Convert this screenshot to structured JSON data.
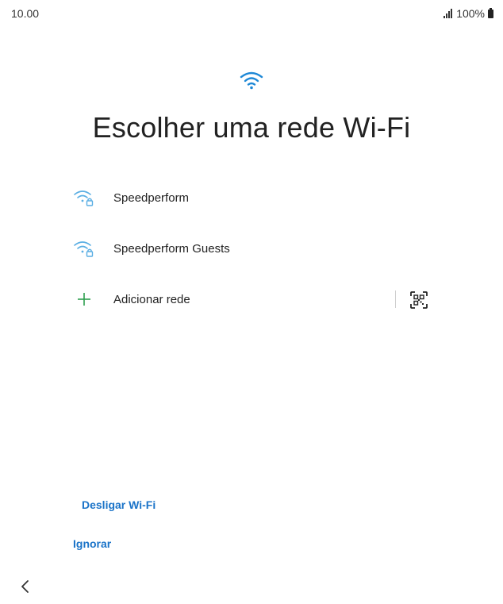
{
  "status_bar": {
    "time": "10.00",
    "battery": "100%"
  },
  "header": {
    "title": "Escolher uma rede Wi-Fi",
    "icon": "wifi-icon"
  },
  "networks": [
    {
      "label": "Speedperform",
      "icon": "wifi-locked-icon"
    },
    {
      "label": "Speedperform Guests",
      "icon": "wifi-locked-icon"
    }
  ],
  "add_network": {
    "label": "Adicionar rede",
    "icon": "plus-icon",
    "qr_icon": "qr-scan-icon"
  },
  "footer": {
    "wifi_off_label": "Desligar Wi-Fi",
    "skip_label": "Ignorar",
    "back_icon": "chevron-left-icon"
  },
  "colors": {
    "accent": "#1a73c8",
    "wifi_icon": "#1e88d6",
    "wifi_list_icon": "#5aaee3",
    "plus_icon": "#2e9e4f"
  }
}
